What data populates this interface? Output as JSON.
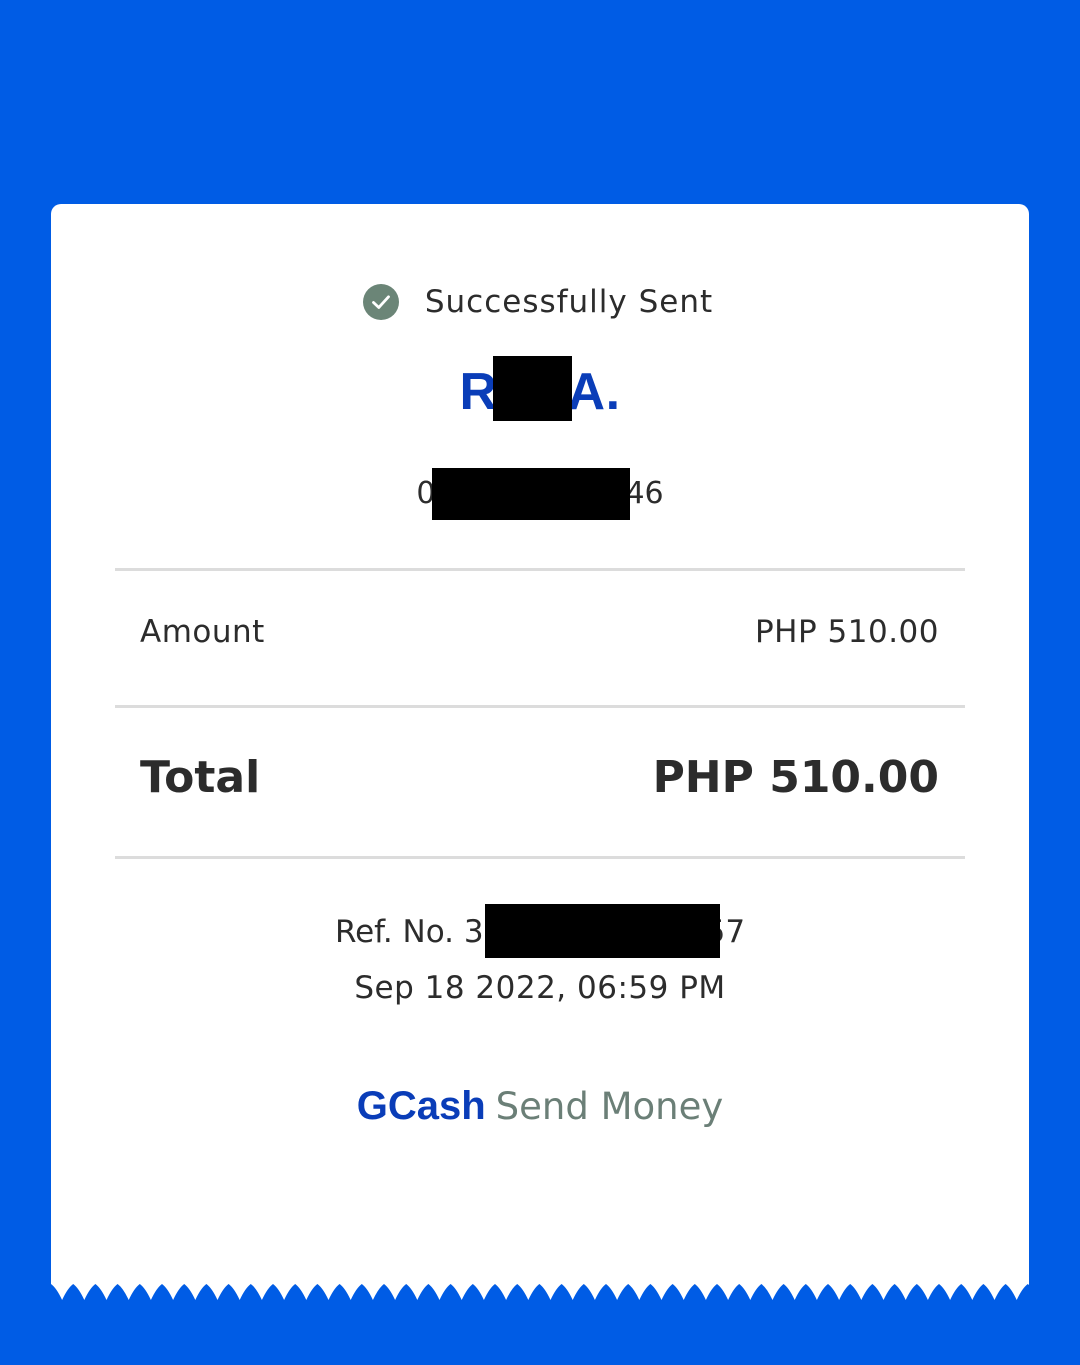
{
  "status": {
    "icon": "check-circle-icon",
    "icon_color": "#6b8577",
    "text": "Successfully Sent"
  },
  "recipient": {
    "name_visible_prefix": "R",
    "name_visible_suffix": "A.",
    "number_visible_prefix": "0",
    "number_visible_suffix": "46"
  },
  "details": {
    "amount_label": "Amount",
    "amount_value": "PHP 510.00",
    "total_label": "Total",
    "total_value": "PHP 510.00"
  },
  "transaction": {
    "ref_prefix": "Ref. No. 3",
    "ref_suffix": "57",
    "datetime": "Sep 18 2022, 06:59 PM"
  },
  "footer": {
    "brand": "GCash",
    "service": "Send Money"
  },
  "colors": {
    "background": "#005ce5",
    "brand_blue": "#0a3db8",
    "text": "#2c2c2c",
    "muted_green": "#6b7f77"
  }
}
